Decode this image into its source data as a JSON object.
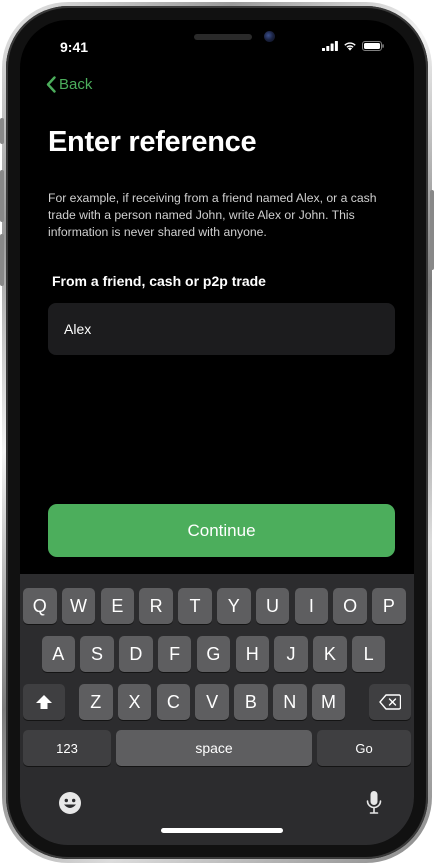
{
  "status_bar": {
    "time": "9:41"
  },
  "nav": {
    "back_label": "Back"
  },
  "page": {
    "title": "Enter reference",
    "description": "For example, if receiving from a friend named Alex, or a cash trade with a person named John, write Alex or John. This information is never shared with anyone.",
    "field_label": "From a friend, cash or p2p trade",
    "input_value": "Alex",
    "continue_label": "Continue"
  },
  "keyboard": {
    "row1": [
      "Q",
      "W",
      "E",
      "R",
      "T",
      "Y",
      "U",
      "I",
      "O",
      "P"
    ],
    "row2": [
      "A",
      "S",
      "D",
      "F",
      "G",
      "H",
      "J",
      "K",
      "L"
    ],
    "row3": [
      "Z",
      "X",
      "C",
      "V",
      "B",
      "N",
      "M"
    ],
    "numbers_label": "123",
    "space_label": "space",
    "go_label": "Go"
  },
  "icons": {
    "back": "chevron-left-icon",
    "signal": "cellular-signal-icon",
    "wifi": "wifi-icon",
    "battery": "battery-icon",
    "shift": "shift-icon",
    "delete": "delete-icon",
    "emoji": "emoji-icon",
    "mic": "microphone-icon"
  },
  "colors": {
    "accent": "#4cae5c",
    "background": "#000000",
    "input_bg": "#1c1c1e",
    "keyboard_bg": "#2c2c2e",
    "key_bg": "#5e5e60",
    "key_dark_bg": "#3f3f41"
  }
}
